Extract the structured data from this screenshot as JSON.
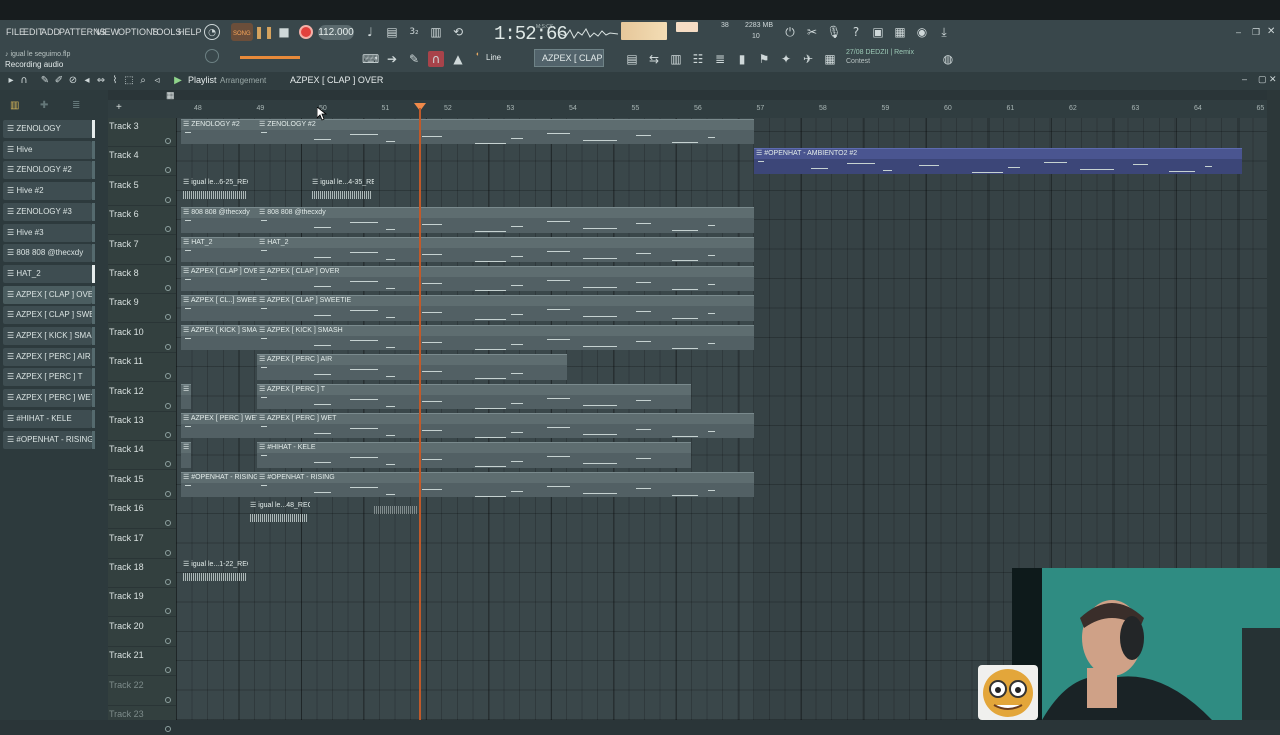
{
  "menu": [
    "FILE",
    "EDIT",
    "ADD",
    "PATTERNS",
    "VIEW",
    "OPTIONS",
    "TOOLS",
    "HELP"
  ],
  "hint": {
    "file": "♪ igual le seguimo.flp",
    "status": "Recording audio"
  },
  "transport": {
    "song_label": "SONG",
    "bpm": "112.000",
    "time": "1:52:66",
    "time_unit": "M:S:CS"
  },
  "cpu": {
    "memory": "2283 MB",
    "voices": "38",
    "cpu_count": "10"
  },
  "news": {
    "line1": "27/08 DEDZII | Remix",
    "line2": "Contest"
  },
  "toolbar": {
    "snap": "Line",
    "pattern": "AZPEX [ CLAP ] OVER"
  },
  "playlist": {
    "title": "Playlist",
    "subtitle": "Arrangement",
    "pattern": "AZPEX [ CLAP ] OVER"
  },
  "channels": [
    "ZENOLOGY",
    "Hive",
    "ZENOLOGY #2",
    "Hive #2",
    "ZENOLOGY #3",
    "Hive #3",
    "808 808 @thecxdy",
    "HAT_2",
    "AZPEX [ CLAP ] OVER",
    "AZPEX [ CLAP ] SWEETIE",
    "AZPEX [ KICK ] SMASH",
    "AZPEX [ PERC ] AIR",
    "AZPEX [ PERC ] T",
    "AZPEX [ PERC ] WET",
    "#HIHAT - KELE",
    "#OPENHAT - RISING"
  ],
  "ruler": [
    "48",
    "49",
    "50",
    "51",
    "52",
    "53",
    "54",
    "55",
    "56",
    "57",
    "58",
    "59",
    "60",
    "61",
    "62",
    "63",
    "64",
    "65"
  ],
  "tracks": [
    "Track 3",
    "Track 4",
    "Track 5",
    "Track 6",
    "Track 7",
    "Track 8",
    "Track 9",
    "Track 10",
    "Track 11",
    "Track 12",
    "Track 13",
    "Track 14",
    "Track 15",
    "Track 16",
    "Track 17",
    "Track 18",
    "Track 19",
    "Track 20",
    "Track 21",
    "Track 22",
    "Track 23"
  ],
  "clips": [
    {
      "name": "ZENOLOGY #2",
      "track": 0
    },
    {
      "name": "ZENOLOGY #2",
      "track": 0
    },
    {
      "name": "#OPENHAT - AMBIENTO2 #2",
      "track": 1
    },
    {
      "name": "igual le...6-25_REC",
      "track": 2
    },
    {
      "name": "igual le...4-35_REC",
      "track": 2
    },
    {
      "name": "808 808 @thecxdy",
      "track": 3
    },
    {
      "name": "808 808 @thecxdy",
      "track": 3
    },
    {
      "name": "HAT_2",
      "track": 4
    },
    {
      "name": "HAT_2",
      "track": 4
    },
    {
      "name": "AZPEX [ CLAP ] OVER",
      "track": 5
    },
    {
      "name": "AZPEX [ CLAP ] OVER",
      "track": 5
    },
    {
      "name": "AZPEX [ CL..] SWEETIE",
      "track": 6
    },
    {
      "name": "AZPEX [ CLAP ] SWEETIE",
      "track": 6
    },
    {
      "name": "AZPEX [ KICK ] SMASH",
      "track": 7
    },
    {
      "name": "AZPEX [ KICK ] SMASH",
      "track": 7
    },
    {
      "name": "AZPEX [ PERC ] AIR",
      "track": 8
    },
    {
      "name": "",
      "track": 9
    },
    {
      "name": "AZPEX [ PERC ] T",
      "track": 9
    },
    {
      "name": "AZPEX [ PERC ] WET",
      "track": 10
    },
    {
      "name": "AZPEX [ PERC ] WET",
      "track": 10
    },
    {
      "name": "",
      "track": 11
    },
    {
      "name": "#HIHAT - KELE",
      "track": 11
    },
    {
      "name": "#OPENHAT - RISING",
      "track": 12
    },
    {
      "name": "#OPENHAT - RISING",
      "track": 12
    },
    {
      "name": "igual le...48_REC",
      "track": 13
    },
    {
      "name": "igual le...1-22_REC",
      "track": 15
    }
  ]
}
